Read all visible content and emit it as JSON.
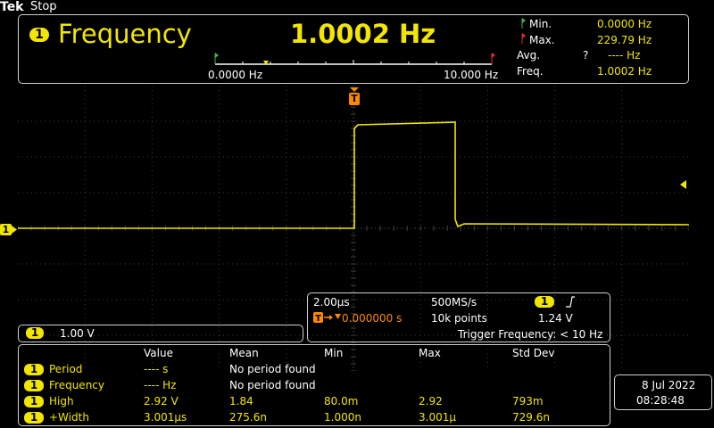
{
  "brand": "Tek",
  "run_state": "Stop",
  "freq_panel": {
    "channel": "1",
    "title": "Frequency",
    "value": "1.0002 Hz",
    "scale_min": "0.0000 Hz",
    "scale_max": "10.000 Hz",
    "stats": [
      {
        "label": "Min.",
        "value": "0.0000 Hz"
      },
      {
        "label": "Max.",
        "value": "229.79 Hz"
      },
      {
        "label": "Avg.",
        "flag": "?",
        "value": "---- Hz"
      },
      {
        "label": "Freq.",
        "value": "1.0002 Hz"
      }
    ]
  },
  "trigger_marker": "T",
  "channel_marker": "1",
  "channel_scale": {
    "channel": "1",
    "value": "1.00 V"
  },
  "horizontal": {
    "timebase": "2.00µs",
    "sample_rate": "500MS/s",
    "trigger_channel": "1",
    "trigger_delay": "0.000000 s",
    "record_length": "10k points",
    "trigger_level": "1.24 V",
    "trigger_frequency": "Trigger Frequency: < 10 Hz"
  },
  "measurements": {
    "headers": [
      "Value",
      "Mean",
      "Min",
      "Max",
      "Std Dev"
    ],
    "rows": [
      {
        "ch": "1",
        "name": "Period",
        "value": "---- s",
        "mean": "No period found",
        "min": "",
        "max": "",
        "std": ""
      },
      {
        "ch": "1",
        "name": "Frequency",
        "value": "---- Hz",
        "mean": "No period found",
        "min": "",
        "max": "",
        "std": ""
      },
      {
        "ch": "1",
        "name": "High",
        "value": "2.92 V",
        "mean": "1.84",
        "min": "80.0m",
        "max": "2.92",
        "std": "793m"
      },
      {
        "ch": "1",
        "name": "+Width",
        "value": "3.001µs",
        "mean": "275.6n",
        "min": "1.000n",
        "max": "3.001µ",
        "std": "729.6n"
      }
    ]
  },
  "datetime": {
    "date": "8 Jul  2022",
    "time": "08:28:48"
  },
  "colors": {
    "ch1": "#f2e600",
    "trigger": "#ff8a00",
    "grid": "#3c3c3c",
    "border": "#cfcfcf"
  }
}
